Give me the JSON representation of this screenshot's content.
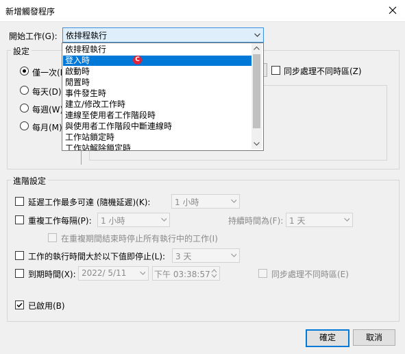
{
  "window": {
    "title": "新增觸發程序"
  },
  "start_task": {
    "label": "開始工作(G):",
    "value": "依排程執行",
    "options": [
      "依排程執行",
      "登入時",
      "啟動時",
      "閒置時",
      "事件發生時",
      "建立/修改工作時",
      "連線至使用者工作階段時",
      "與使用者工作階段中斷連線時",
      "工作站鎖定時",
      "工作站解除鎖定時"
    ],
    "selected_option": "登入時",
    "cursor_glyph": "C"
  },
  "settings": {
    "group_label": "設定",
    "radios": [
      "僅一次(N",
      "每天(D)",
      "每週(W)",
      "每月(M)"
    ],
    "selected_radio": "僅一次(N",
    "sync_timezone_label": "同步處理不同時區(Z)"
  },
  "advanced": {
    "group_label": "進階設定",
    "delay_label": "延遲工作最多可達 (隨機延遲)(K):",
    "delay_value": "1 小時",
    "repeat_label": "重複工作每隔(P):",
    "repeat_value": "1 小時",
    "duration_label": "持續時間為(F):",
    "duration_value": "1 天",
    "stop_running_label": "在重複期間結束時停止所有執行中的工作(I)",
    "stop_if_longer_label": "工作的執行時間大於以下值即停止(L):",
    "stop_if_longer_value": "3 天",
    "expire_label": "到期時間(X):",
    "expire_date": "2022/  5/11",
    "expire_time": "下午 03:38:57",
    "expire_sync_label": "同步處理不同時區(E)",
    "enabled_label": "已啟用(B)",
    "enabled_checked": true
  },
  "buttons": {
    "ok": "確定",
    "cancel": "取消"
  },
  "colors": {
    "accent": "#0078d7",
    "cursor_red": "#e0243c"
  }
}
